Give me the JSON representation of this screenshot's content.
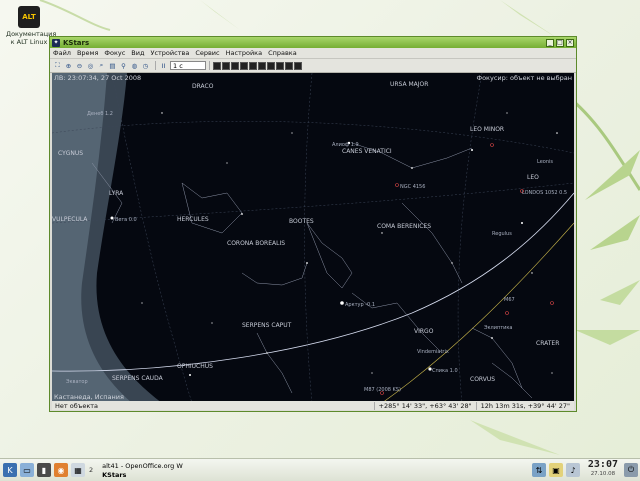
{
  "desktop": {
    "icon_label_line1": "Документация",
    "icon_label_line2": "к ALT Linux",
    "icon_text": "ALT"
  },
  "window": {
    "title": "KStars",
    "controls": {
      "minimize": "_",
      "maximize": "□",
      "close": "×"
    }
  },
  "menu": [
    "Файл",
    "Время",
    "Фокус",
    "Вид",
    "Устройства",
    "Сервис",
    "Настройка",
    "Справка"
  ],
  "toolbar": {
    "time_step": "1 с",
    "pause_label": "II"
  },
  "sky": {
    "datetime": "ЛВ: 23:07:34, 27 Oct 2008",
    "focus_info": "Фокусир: объект не выбран",
    "location": "Кастанеда, Испания",
    "constellations": [
      "DRACO",
      "URSA MAJOR",
      "LEO MINOR",
      "CYGNUS",
      "CANES VENATICI",
      "LYRA",
      "LEO",
      "HERCULES",
      "BOOTES",
      "COMA BERENICES",
      "CORONA BOREALIS",
      "VIRGO",
      "SERPENS CAPUT",
      "CRATER",
      "OPHIUCHUS",
      "SERPENS CAUDA",
      "CORVUS",
      "VULPECULA"
    ],
    "objects": [
      "Арктур -0.1",
      "Спика 1.0",
      "Алиоф 1.9",
      "Вега 0.0",
      "Денеб 1.2",
      "NGC 4156",
      "Экватор",
      "Эклиптика",
      "LONDOS 1052 0.5",
      "Regulus",
      "M87 (2008 KS)",
      "Vindemiatrix",
      "Leonis",
      "M67"
    ]
  },
  "status": {
    "object": "Нет объекта",
    "altaz": "+285° 14' 33\",  +63° 43' 28\"",
    "radec": "12h 13m 31s,  +39° 44' 27\""
  },
  "taskbar": {
    "tasks": [
      "alt41 - OpenOffice.org W",
      "KStars"
    ],
    "desktop_number": "2",
    "time": "23:07",
    "date": "27.10.08"
  }
}
